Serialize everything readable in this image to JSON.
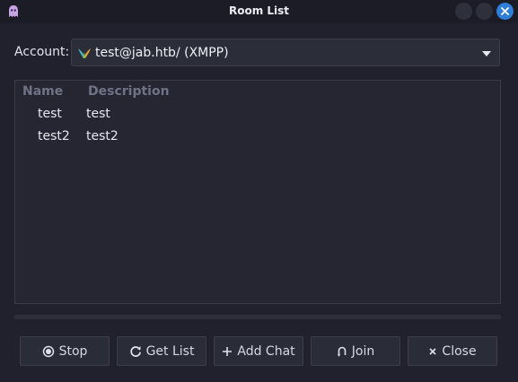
{
  "window": {
    "title": "Room List"
  },
  "account": {
    "label": "Account:",
    "value": "test@jab.htb/ (XMPP)"
  },
  "table": {
    "headers": {
      "name": "Name",
      "description": "Description"
    },
    "rows": [
      {
        "name": "test",
        "description": "test"
      },
      {
        "name": "test2",
        "description": "test2"
      }
    ]
  },
  "buttons": {
    "stop": "Stop",
    "get_list": "Get List",
    "add_chat": "Add Chat",
    "join": "Join",
    "close": "Close"
  },
  "colors": {
    "accent": "#2f7ed8",
    "background": "#20212c"
  }
}
